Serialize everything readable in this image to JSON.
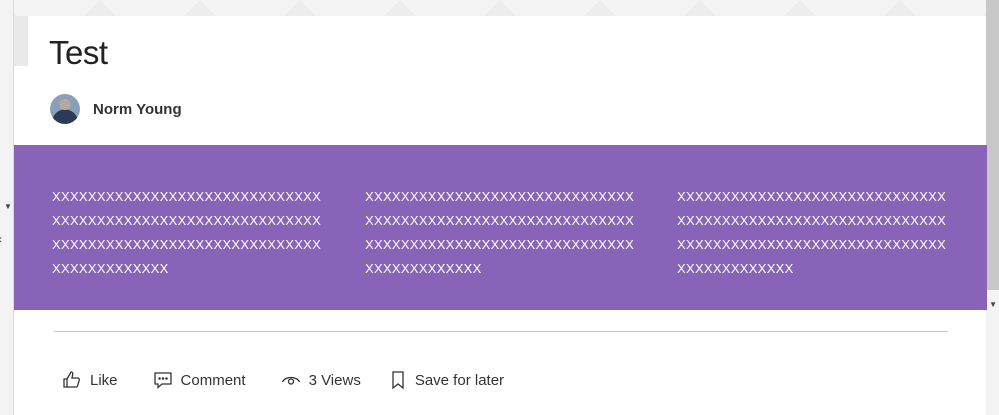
{
  "post": {
    "title": "Test",
    "author": {
      "name": "Norm Young"
    }
  },
  "banner": {
    "background_color": "#8764b8",
    "columns": [
      {
        "text": "XXXXXXXXXXXXXXXXXXXXXXXXXXXXXXXXXXXXXXXXXXXXXXXXXXXXXXXXXXXXXXXXXXXXXXXXXXXXXXXXXXXXXXXXXXXXXXXXXXXXXXX"
      },
      {
        "text": "XXXXXXXXXXXXXXXXXXXXXXXXXXXXXXXXXXXXXXXXXXXXXXXXXXXXXXXXXXXXXXXXXXXXXXXXXXXXXXXXXXXXXXXXXXXXXXXXXXXXXXX"
      },
      {
        "text": "XXXXXXXXXXXXXXXXXXXXXXXXXXXXXXXXXXXXXXXXXXXXXXXXXXXXXXXXXXXXXXXXXXXXXXXXXXXXXXXXXXXXXXXXXXXXXXXXXXXXXXX"
      }
    ]
  },
  "actions": {
    "like": {
      "label": "Like",
      "icon": "thumbs-up-icon"
    },
    "comment": {
      "label": "Comment",
      "icon": "comment-icon"
    },
    "views": {
      "label": "3 Views",
      "icon": "eye-icon"
    },
    "save": {
      "label": "Save for later",
      "icon": "bookmark-icon"
    }
  }
}
